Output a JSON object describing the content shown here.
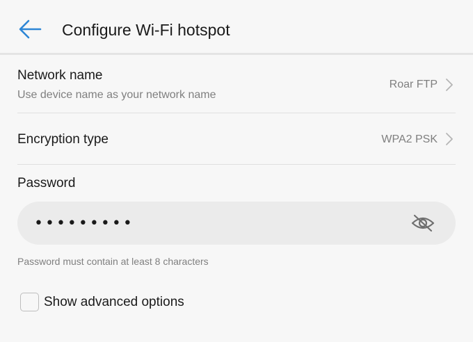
{
  "header": {
    "title": "Configure Wi-Fi hotspot",
    "back_icon": "back-arrow-icon",
    "accent_color": "#2d86d6"
  },
  "network_name": {
    "label": "Network name",
    "subtitle": "Use device name as your network name",
    "value": "Roar FTP"
  },
  "encryption": {
    "label": "Encryption type",
    "value": "WPA2 PSK"
  },
  "password": {
    "label": "Password",
    "value": "•••••••••",
    "visibility_icon": "eye-off-icon",
    "hint": "Password must contain at least 8 characters"
  },
  "advanced": {
    "label": "Show advanced options",
    "checked": false
  }
}
